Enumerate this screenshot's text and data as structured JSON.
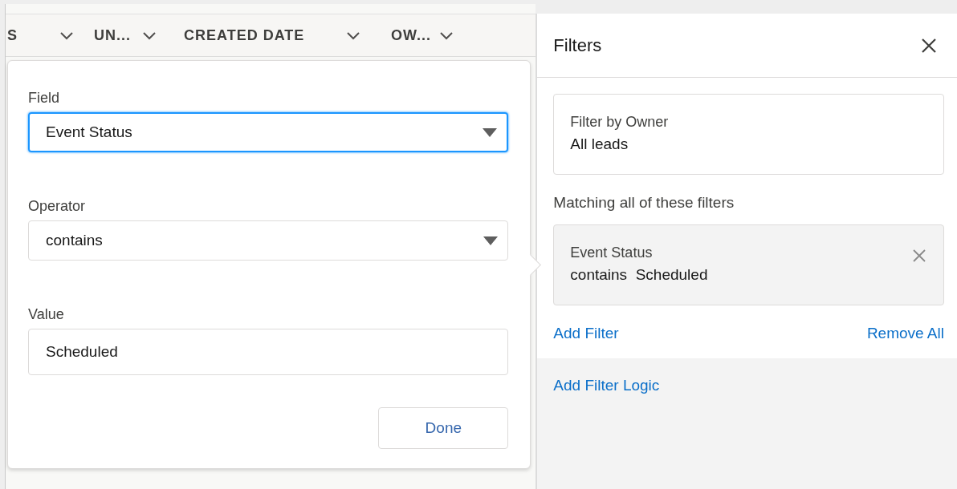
{
  "table": {
    "columns": [
      {
        "label": "S"
      },
      {
        "label": "UN..."
      },
      {
        "label": "CREATED DATE"
      },
      {
        "label": "OW..."
      }
    ]
  },
  "filter_editor": {
    "fields": [
      {
        "kind": "select",
        "label": "Field",
        "value": "Event Status",
        "focused": true
      },
      {
        "kind": "select",
        "label": "Operator",
        "value": "contains",
        "focused": false
      },
      {
        "kind": "text",
        "label": "Value",
        "value": "Scheduled",
        "focused": false
      }
    ],
    "done_button": "Done"
  },
  "filters_panel": {
    "title": "Filters",
    "owner": {
      "label": "Filter by Owner",
      "value": "All leads"
    },
    "matching_label": "Matching all of these filters",
    "filters": [
      {
        "field": "Event Status",
        "operator": "contains",
        "value": "Scheduled"
      }
    ],
    "add_filter": "Add Filter",
    "remove_all": "Remove All",
    "add_filter_logic": "Add Filter Logic"
  }
}
